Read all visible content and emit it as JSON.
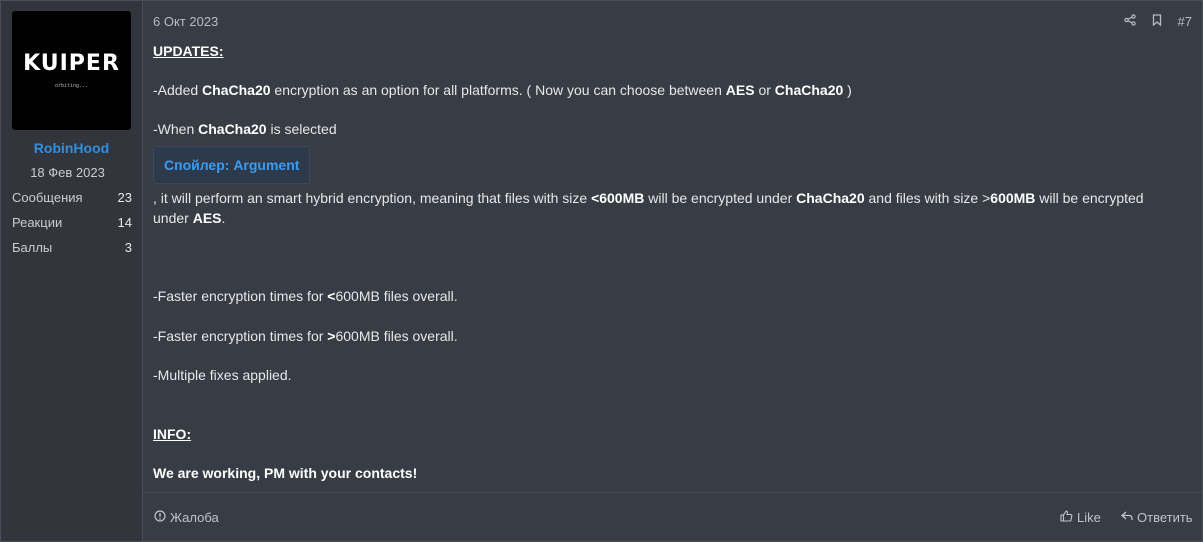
{
  "author": {
    "avatar_logo": "KUIPER",
    "avatar_tagline": "orbiting...",
    "username": "RobinHood",
    "join_date": "18 Фев 2023",
    "stats": [
      {
        "label": "Сообщения",
        "value": "23"
      },
      {
        "label": "Реакции",
        "value": "14"
      },
      {
        "label": "Баллы",
        "value": "3"
      }
    ]
  },
  "post": {
    "date": "6 Окт 2023",
    "number": "#7",
    "updates_heading": "UPDATES:",
    "line1_a": "-Added ",
    "line1_b": "ChaCha20",
    "line1_c": " encryption as an option for all platforms. ( Now you can choose between ",
    "line1_d": "AES",
    "line1_e": " or ",
    "line1_f": "ChaCha20",
    "line1_g": " )",
    "line2_a": "-When ",
    "line2_b": "ChaCha20",
    "line2_c": " is selected",
    "spoiler_label": "Спойлер: Argument",
    "line3_a": ", it will perform an smart hybrid encryption, meaning that files with size ",
    "line3_b": "<600MB",
    "line3_c": " will be encrypted under ",
    "line3_d": "ChaCha20",
    "line3_e": " and files with size >",
    "line3_f": "600MB",
    "line3_g": " will be encrypted",
    "line3_h": "under ",
    "line3_i": "AES",
    "line3_j": ".",
    "line4_a": "-Faster encryption times for ",
    "line4_b": "<",
    "line4_c": "600MB files overall.",
    "line5_a": "-Faster encryption times for ",
    "line5_b": ">",
    "line5_c": "600MB files overall.",
    "line6": "-Multiple fixes applied.",
    "info_heading": "INFO:",
    "closing": "We are working, PM with your contacts!"
  },
  "footer": {
    "report_label": "Жалоба",
    "like_label": "Like",
    "reply_label": "Ответить"
  },
  "icons": [
    "share-icon",
    "bookmark-icon",
    "report-icon",
    "like-icon",
    "reply-icon"
  ]
}
